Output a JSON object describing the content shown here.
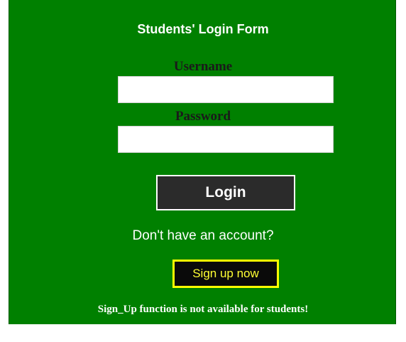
{
  "form": {
    "title": "Students' Login Form",
    "username_label": "Username",
    "username_value": "",
    "password_label": "Password",
    "password_value": "",
    "login_label": "Login",
    "account_prompt": "Don't have an account?",
    "signup_label": "Sign up now",
    "notice": "Sign_Up function is not available for students!"
  },
  "colors": {
    "panel_background": "#008000",
    "login_button_background": "#2b2b2b",
    "signup_border": "#ffff00",
    "signup_text": "#ffff33"
  }
}
